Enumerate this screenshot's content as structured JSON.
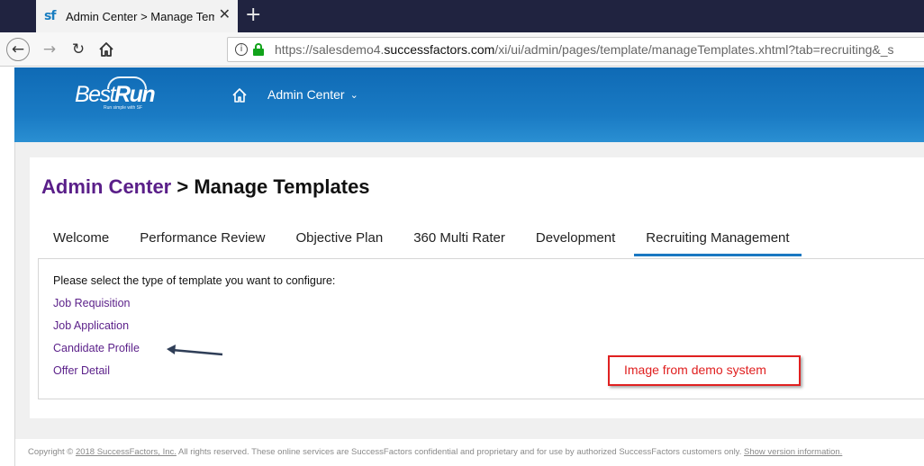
{
  "browser": {
    "tab_title": "Admin Center > Manage Templ",
    "favicon_text": "sf",
    "close_glyph": "✕",
    "new_tab_glyph": "+",
    "back_glyph": "←",
    "forward_glyph": "→",
    "reload_glyph": "↻",
    "info_glyph": "i",
    "url_prefix": "https://salesdemo4.",
    "url_domain": "successfactors.com",
    "url_path": "/xi/ui/admin/pages/template/manageTemplates.xhtml?tab=recruiting&_s"
  },
  "header": {
    "logo_best": "Best",
    "logo_run": "Run",
    "logo_tagline": "Run simple with SF",
    "admin_menu_label": "Admin Center",
    "chevron_glyph": "⌄"
  },
  "page": {
    "breadcrumb": "Admin Center",
    "separator": " > ",
    "title": "Manage Templates",
    "tabs": [
      {
        "label": "Welcome"
      },
      {
        "label": "Performance Review"
      },
      {
        "label": "Objective Plan"
      },
      {
        "label": "360 Multi Rater"
      },
      {
        "label": "Development"
      },
      {
        "label": "Recruiting Management",
        "active": true
      }
    ],
    "prompt": "Please select the type of template you want to configure:",
    "template_links": [
      {
        "label": "Job Requisition"
      },
      {
        "label": "Job Application"
      },
      {
        "label": "Candidate Profile"
      },
      {
        "label": "Offer Detail"
      }
    ],
    "callout": "Image from demo system"
  },
  "footer": {
    "prefix": "Copyright © ",
    "company_link": "2018 SuccessFactors, Inc.",
    "text": " All rights reserved. These online services are SuccessFactors confidential and proprietary and for use by authorized SuccessFactors customers only. ",
    "version_link": "Show version information."
  },
  "colors": {
    "header_blue": "#1a7bc4",
    "link_purple": "#5a1f89",
    "tab_active_underline": "#1a78c2",
    "callout_red": "#e02020",
    "lock_green": "#12a31b"
  },
  "icons": [
    "sf-favicon",
    "close-icon",
    "plus-icon",
    "back-arrow-icon",
    "forward-arrow-icon",
    "reload-icon",
    "home-icon",
    "info-icon",
    "lock-icon",
    "chevron-down-icon",
    "arrow-pointer-icon"
  ]
}
